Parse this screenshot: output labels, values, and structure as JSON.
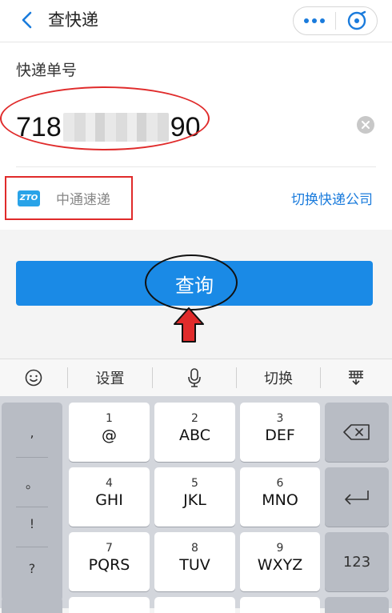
{
  "header": {
    "title": "查快递"
  },
  "form": {
    "label": "快递单号",
    "number_prefix": "718",
    "number_suffix": "90",
    "company_logo_text": "ZTO",
    "company_name": "中通速递",
    "switch_company": "切换快递公司"
  },
  "query_button": {
    "label": "查询"
  },
  "keyboard": {
    "toolbar": {
      "settings": "设置",
      "switch": "切换"
    },
    "punctuation": [
      ",",
      "。",
      "!",
      "?"
    ],
    "keys": [
      {
        "digit": "1",
        "letters": "@"
      },
      {
        "digit": "2",
        "letters": "ABC"
      },
      {
        "digit": "3",
        "letters": "DEF"
      },
      {
        "digit": "4",
        "letters": "GHI"
      },
      {
        "digit": "5",
        "letters": "JKL"
      },
      {
        "digit": "6",
        "letters": "MNO"
      },
      {
        "digit": "7",
        "letters": "PQRS"
      },
      {
        "digit": "8",
        "letters": "TUV"
      },
      {
        "digit": "9",
        "letters": "WXYZ"
      }
    ],
    "num_key": "123"
  },
  "colors": {
    "accent": "#1a8ae6",
    "annotation_red": "#e02b2b"
  }
}
